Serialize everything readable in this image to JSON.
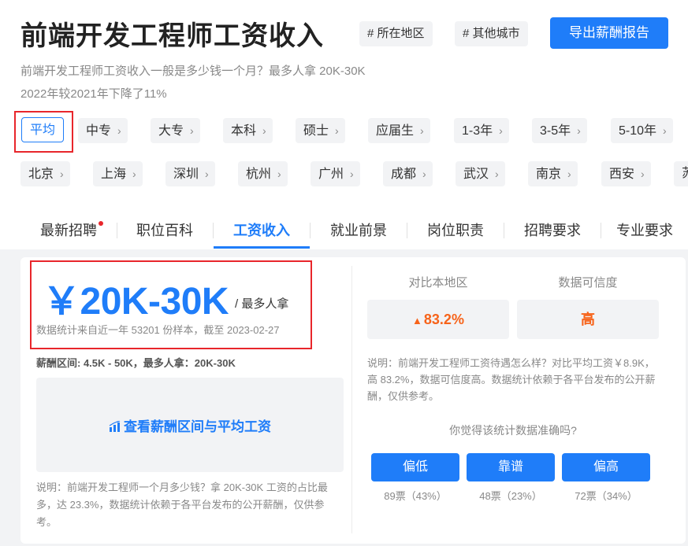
{
  "header": {
    "title": "前端开发工程师工资收入",
    "tags": [
      "# 所在地区",
      "# 其他城市"
    ],
    "export_label": "导出薪酬报告",
    "subtitle": "前端开发工程师工资收入一般是多少钱一个月？最多人拿 20K-30K",
    "change_line": "2022年较2021年下降了11%"
  },
  "filters": {
    "education": [
      "平均",
      "中专",
      "大专",
      "本科",
      "硕士",
      "应届生",
      "1-3年",
      "3-5年",
      "5-10年"
    ],
    "cities": [
      "北京",
      "上海",
      "深圳",
      "杭州",
      "广州",
      "成都",
      "武汉",
      "南京",
      "西安",
      "苏"
    ],
    "selected": "平均"
  },
  "tabs": [
    "最新招聘",
    "职位百科",
    "工资收入",
    "就业前景",
    "岗位职责",
    "招聘要求",
    "专业要求"
  ],
  "active_tab": "工资收入",
  "salary": {
    "value": "￥20K-30K",
    "suffix": "/ 最多人拿",
    "sample_note": "数据统计来自近一年 53201 份样本，截至 2023-02-27",
    "range_line": "薪酬区间: 4.5K - 50K，最多人拿：20K-30K",
    "range_link": "查看薪酬区间与平均工资",
    "description": "说明：前端开发工程师一个月多少钱？拿 20K-30K 工资的占比最多，达 23.3%，数据统计依赖于各平台发布的公开薪酬，仅供参考。"
  },
  "stats": {
    "compare_label": "对比本地区",
    "compare_value": "83.2%",
    "credibility_label": "数据可信度",
    "credibility_value": "高",
    "description": "说明：前端开发工程师工资待遇怎么样？对比平均工资￥8.9K，高 83.2%，数据可信度高。数据统计依赖于各平台发布的公开薪酬，仅供参考。"
  },
  "vote": {
    "question": "你觉得该统计数据准确吗?",
    "options": [
      {
        "label": "偏低",
        "count": "89票（43%）"
      },
      {
        "label": "靠谱",
        "count": "48票（23%）"
      },
      {
        "label": "偏高",
        "count": "72票（34%）"
      }
    ]
  },
  "colors": {
    "accent": "#1f7df9",
    "highlight": "#f7631a",
    "annotation_box": "#e8262b"
  }
}
